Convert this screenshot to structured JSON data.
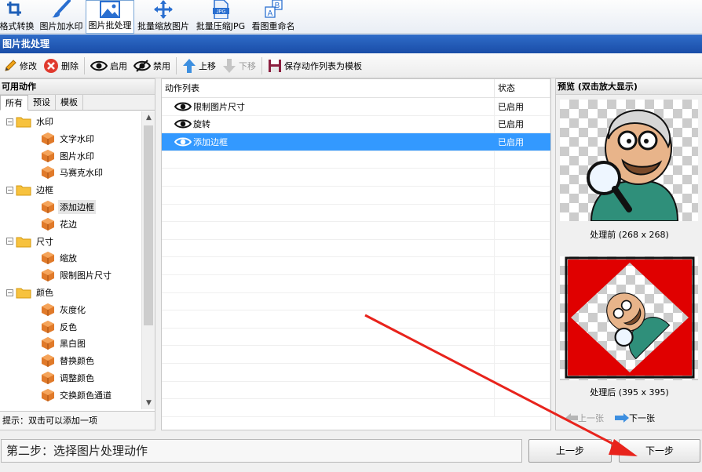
{
  "top_toolbar": {
    "items": [
      {
        "label": "格式转换",
        "icon": "crop-rotate-icon"
      },
      {
        "label": "图片加水印",
        "icon": "brush-icon"
      },
      {
        "label": "图片批处理",
        "icon": "image-icon",
        "active": true
      },
      {
        "label": "批量缩放图片",
        "icon": "move-arrows-icon"
      },
      {
        "label": "批量压缩JPG",
        "icon": "jpg-file-icon"
      },
      {
        "label": "看图重命名",
        "icon": "rename-ab-icon"
      }
    ]
  },
  "title_bar": {
    "text": "图片批处理"
  },
  "action_toolbar": {
    "edit": "修改",
    "delete": "删除",
    "enable": "启用",
    "disable": "禁用",
    "move_up": "上移",
    "move_down": "下移",
    "save_template": "保存动作列表为模板"
  },
  "left_panel": {
    "header": "可用动作",
    "tabs": [
      "所有",
      "预设",
      "模板"
    ],
    "tree": [
      {
        "label": "水印",
        "type": "folder"
      },
      {
        "label": "文字水印",
        "type": "item"
      },
      {
        "label": "图片水印",
        "type": "item"
      },
      {
        "label": "马赛克水印",
        "type": "item"
      },
      {
        "label": "边框",
        "type": "folder"
      },
      {
        "label": "添加边框",
        "type": "item",
        "selected": true
      },
      {
        "label": "花边",
        "type": "item"
      },
      {
        "label": "尺寸",
        "type": "folder"
      },
      {
        "label": "缩放",
        "type": "item"
      },
      {
        "label": "限制图片尺寸",
        "type": "item"
      },
      {
        "label": "颜色",
        "type": "folder"
      },
      {
        "label": "灰度化",
        "type": "item"
      },
      {
        "label": "反色",
        "type": "item"
      },
      {
        "label": "黑白图",
        "type": "item"
      },
      {
        "label": "替换颜色",
        "type": "item"
      },
      {
        "label": "调整颜色",
        "type": "item"
      },
      {
        "label": "交换颜色通道",
        "type": "item"
      }
    ],
    "hint": "提示：双击可以添加一项"
  },
  "action_list": {
    "columns": [
      "动作列表",
      "状态"
    ],
    "rows": [
      {
        "name": "限制图片尺寸",
        "status": "已启用"
      },
      {
        "name": "旋转",
        "status": "已启用"
      },
      {
        "name": "添加边框",
        "status": "已启用",
        "selected": true
      }
    ],
    "empty_rows": 15
  },
  "preview": {
    "header": "预览 (双击放大显示)",
    "before_caption": "处理前 (268 x 268)",
    "after_caption": "处理后 (395 x 395)",
    "prev": "上一张",
    "next": "下一张"
  },
  "bottom": {
    "step_text": "第二步：选择图片处理动作",
    "prev_button": "上一步",
    "next_button": "下一步"
  },
  "colors": {
    "title_bar": "#1f55b0",
    "selection": "#3399ff",
    "annotation_arrow": "#e8231c",
    "border_red": "#e00000"
  }
}
